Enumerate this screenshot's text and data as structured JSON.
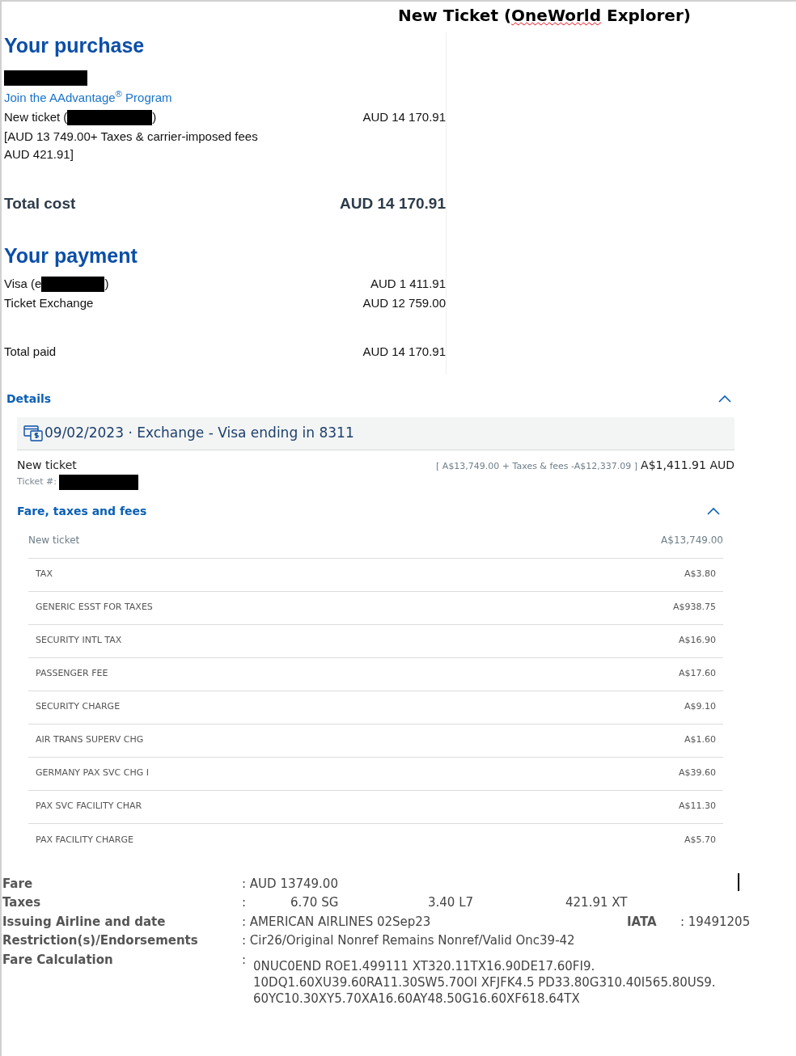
{
  "title": {
    "before": "New Ticket (",
    "flagged": "OneWorld",
    "after": " Explorer)"
  },
  "purchase": {
    "heading": "Your purchase",
    "join_link": "Join the AAdvantage$^{®}$ Program",
    "ticket_prefix": "New ticket (",
    "ticket_suffix": ")",
    "ticket_amount": "AUD 14 170.91",
    "breakdown": "[AUD 13 749.00+ Taxes & carrier-imposed fees AUD 421.91]",
    "total_label": "Total cost",
    "total_amount": "AUD 14 170.91"
  },
  "payment": {
    "heading": "Your payment",
    "visa_prefix": "Visa (e",
    "visa_suffix": ")",
    "visa_amount": "AUD 1 411.91",
    "exchange_label": "Ticket Exchange",
    "exchange_amount": "AUD 12 759.00",
    "total_label": "Total paid",
    "total_amount": "AUD 14 170.91"
  },
  "details": {
    "label": "Details",
    "expanded": true,
    "transaction": "09/02/2023 · Exchange - Visa ending in 8311",
    "ticket_label": "New ticket",
    "ticket_breakdown": "[ A$13,749.00 + Taxes & fees -A$12,337.09 ]",
    "ticket_amount": "A$1,411.91 AUD",
    "ticket_number_label": "Ticket #:",
    "fees": {
      "label": "Fare, taxes and fees",
      "expanded": true,
      "rows": [
        {
          "kind": "fare",
          "name": "New ticket",
          "amount": "A$13,749.00"
        },
        {
          "kind": "tax",
          "name": "TAX",
          "amount": "A$3.80"
        },
        {
          "kind": "tax",
          "name": "GENERIC ESST FOR TAXES",
          "amount": "A$938.75"
        },
        {
          "kind": "tax",
          "name": "SECURITY INTL TAX",
          "amount": "A$16.90"
        },
        {
          "kind": "tax",
          "name": "PASSENGER FEE",
          "amount": "A$17.60"
        },
        {
          "kind": "tax",
          "name": "SECURITY CHARGE",
          "amount": "A$9.10"
        },
        {
          "kind": "tax",
          "name": "AIR TRANS SUPERV CHG",
          "amount": "A$1.60"
        },
        {
          "kind": "tax",
          "name": "GERMANY PAX SVC CHG I",
          "amount": "A$39.60"
        },
        {
          "kind": "tax",
          "name": "PAX SVC FACILITY CHAR",
          "amount": "A$11.30"
        },
        {
          "kind": "tax",
          "name": "PAX FACILITY CHARGE",
          "amount": "A$5.70"
        }
      ]
    }
  },
  "summary": [
    {
      "kind": "text",
      "label": "Fare",
      "value": ": AUD 13749.00"
    },
    {
      "kind": "taxes",
      "label": "Taxes",
      "colon": ":",
      "values": [
        "6.70 SG",
        "3.40 L7",
        "421.91 XT"
      ]
    },
    {
      "kind": "iata",
      "label": "Issuing Airline and date",
      "value": ": AMERICAN AIRLINES 02Sep23",
      "extra_label": "IATA",
      "extra_value": ": 19491205"
    },
    {
      "kind": "text",
      "label": "Restriction(s)/Endorsements",
      "value": ": Cir26/Original Nonref Remains Nonref/Valid Onc39-42"
    },
    {
      "kind": "calc",
      "label": "Fare Calculation",
      "colon": ":",
      "lines": [
        "0NUC0END ROE1.499111 XT320.11TX16.90DE17.60FI9.",
        "10DQ1.60XU39.60RA11.30SW5.70OI XFJFK4.5 PD33.80G310.40I565.80US9.",
        "60YC10.30XY5.70XA16.60AY48.50G16.60XF618.64TX"
      ]
    }
  ]
}
